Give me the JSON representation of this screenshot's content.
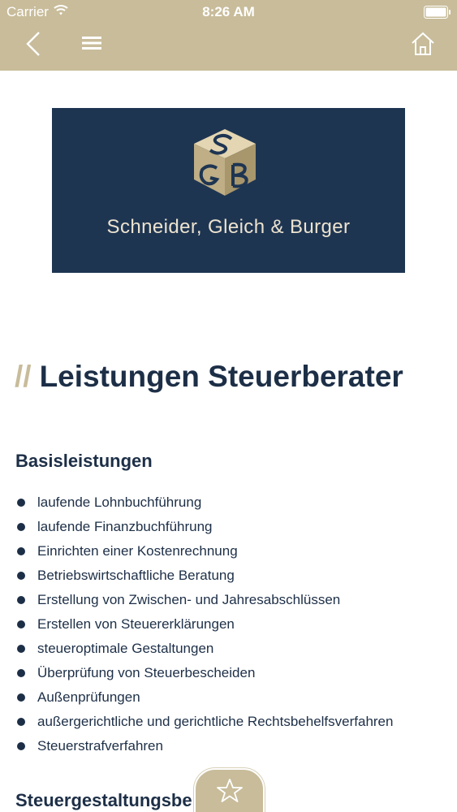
{
  "status_bar": {
    "carrier": "Carrier",
    "time": "8:26 AM"
  },
  "nav": {
    "back_icon": "chevron-left-icon",
    "menu_icon": "hamburger-menu-icon",
    "home_icon": "home-icon"
  },
  "logo": {
    "text": "Schneider, Gleich & Burger",
    "monogram": "SGB",
    "background": "#1e3552",
    "accent": "#c8bc9a"
  },
  "page": {
    "title_prefix": "//",
    "title": "Leistungen Steuerberater"
  },
  "sections": [
    {
      "title": "Basisleistungen",
      "items": [
        "laufende Lohnbuchführung",
        "laufende Finanzbuchführung",
        "Einrichten einer Kostenrechnung",
        "Betriebswirtschaftliche Beratung",
        "Erstellung von Zwischen- und Jahresabschlüssen",
        "Erstellen von Steuererklärungen",
        "steueroptimale Gestaltungen",
        "Überprüfung von Steuerbescheiden",
        "Außenprüfungen",
        "außergerichtliche und gerichtliche Rechtsbehelfsverfahren",
        "Steuerstrafverfahren"
      ]
    },
    {
      "title": "Steuergestaltungsbe"
    }
  ],
  "favorite": {
    "icon": "star-icon"
  },
  "colors": {
    "bar": "#c8bc9a",
    "text": "#1d2f47"
  }
}
